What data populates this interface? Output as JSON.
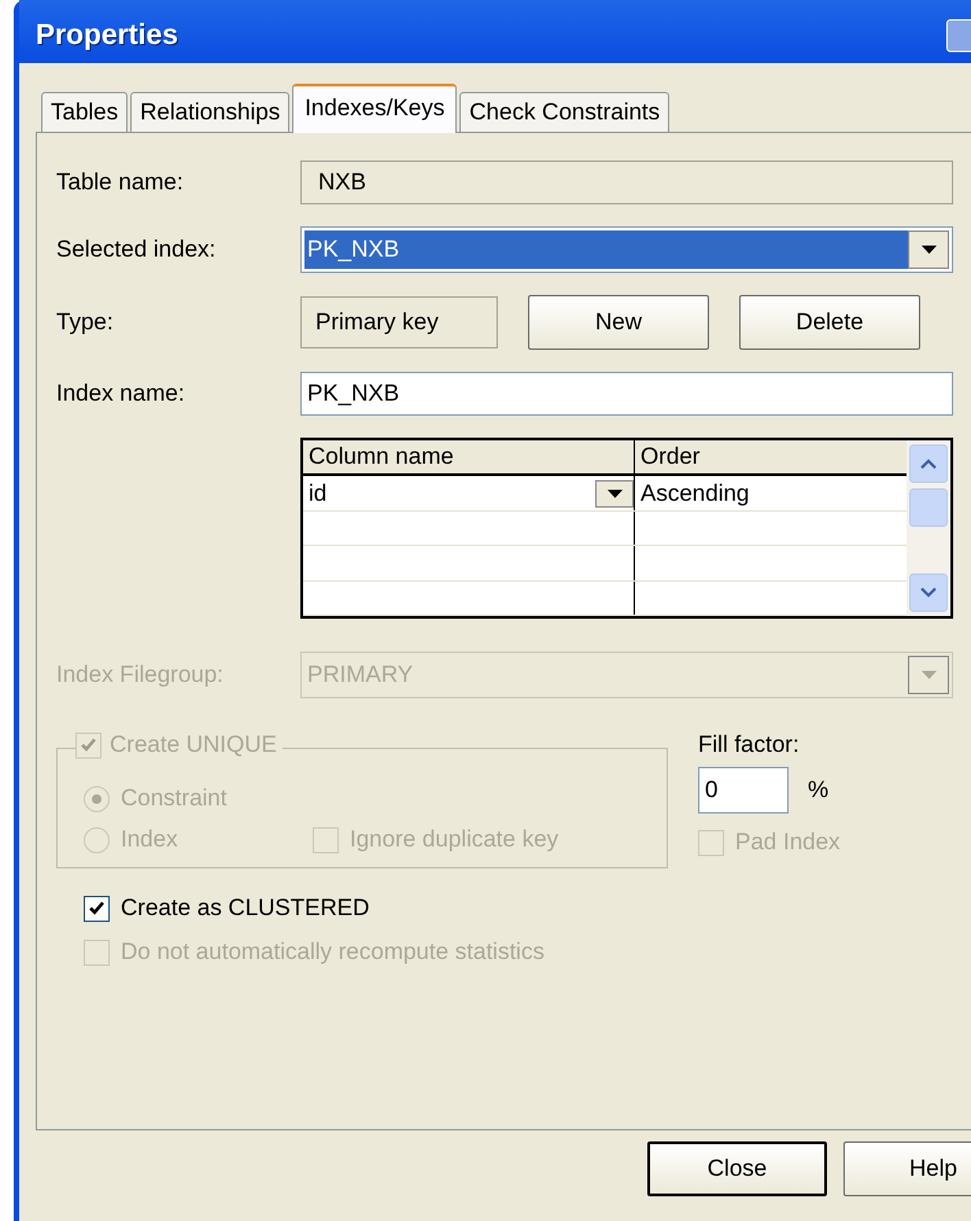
{
  "window": {
    "title": "Properties"
  },
  "tabs": [
    {
      "label": "Tables",
      "selected": false
    },
    {
      "label": "Relationships",
      "selected": false
    },
    {
      "label": "Indexes/Keys",
      "selected": true
    },
    {
      "label": "Check Constraints",
      "selected": false
    }
  ],
  "table_name": {
    "label": "Table name:",
    "value": "NXB"
  },
  "selected_index": {
    "label": "Selected index:",
    "value": "PK_NXB",
    "disabled": false
  },
  "type": {
    "label": "Type:",
    "value": "Primary key"
  },
  "actions": [
    {
      "label": "New"
    },
    {
      "label": "Delete"
    }
  ],
  "index_name": {
    "label": "Index name:",
    "value": "PK_NXB"
  },
  "grid": {
    "columns": [
      "Column name",
      "Order"
    ],
    "rows": [
      {
        "column": "id",
        "order": "Ascending"
      }
    ]
  },
  "filegroup": {
    "label": "Index Filegroup:",
    "value": "PRIMARY",
    "disabled": true
  },
  "unique": {
    "label": "Create UNIQUE",
    "checked": true,
    "disabled": true,
    "options": [
      {
        "label": "Constraint",
        "selected": true,
        "disabled": true
      },
      {
        "label": "Index",
        "selected": false,
        "disabled": true
      }
    ],
    "ignore_duplicate": {
      "label": "Ignore duplicate key",
      "checked": false,
      "disabled": true
    }
  },
  "fill_factor": {
    "label": "Fill factor:",
    "value": "0",
    "unit": "%"
  },
  "pad_index": {
    "label": "Pad Index",
    "checked": false,
    "disabled": true
  },
  "options": [
    {
      "label": "Create as CLUSTERED",
      "checked": true,
      "disabled": false
    },
    {
      "label": "Do not automatically recompute statistics",
      "checked": false,
      "disabled": true
    }
  ],
  "footer_buttons": [
    {
      "label": "Close",
      "default": true
    },
    {
      "label": "Help",
      "default": false
    }
  ]
}
